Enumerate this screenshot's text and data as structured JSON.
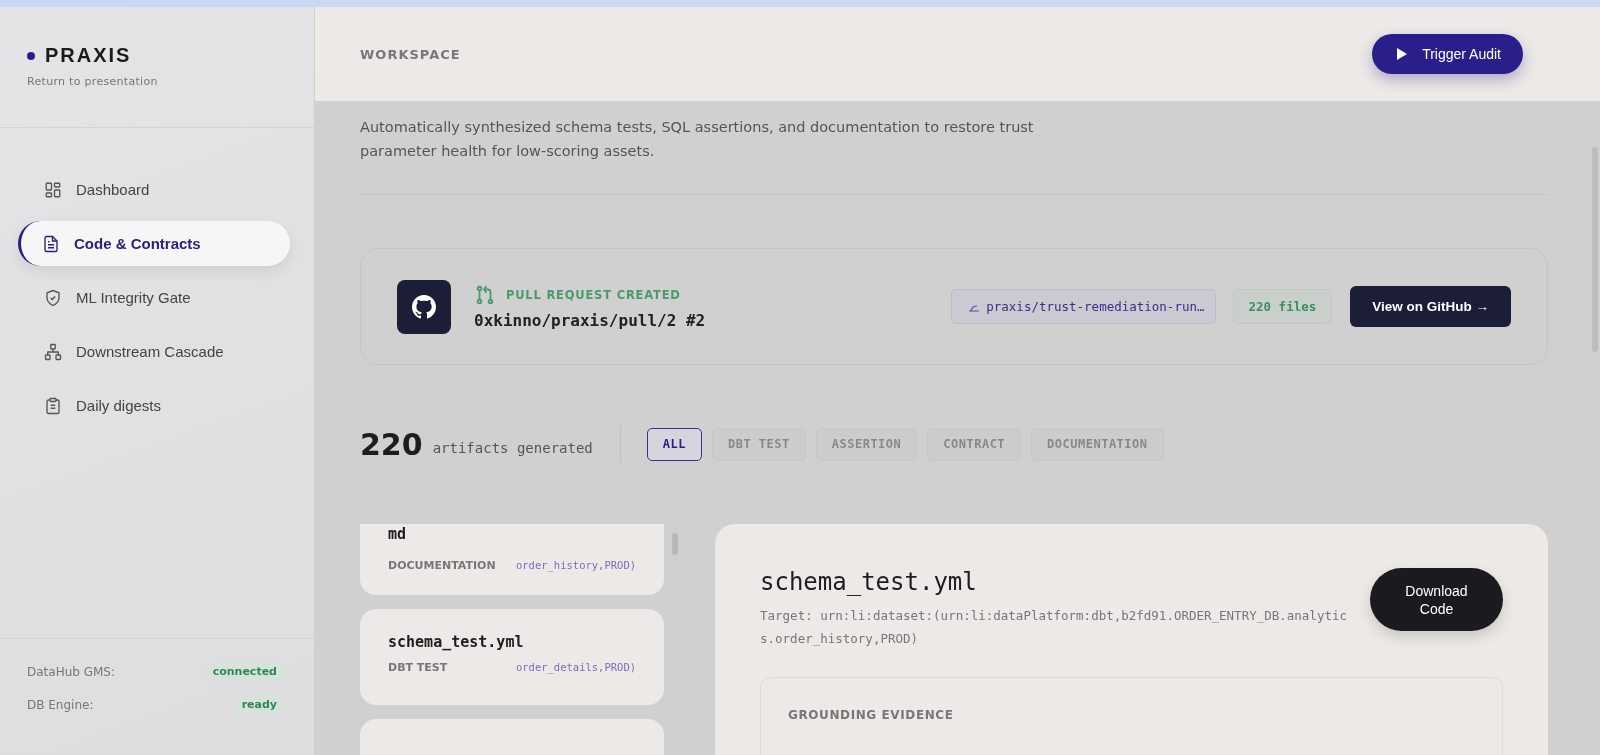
{
  "sidebar": {
    "brand": "PRAXIS",
    "back_link": "Return to presentation",
    "items": [
      {
        "label": "Dashboard",
        "selected": false
      },
      {
        "label": "Code & Contracts",
        "selected": true
      },
      {
        "label": "ML Integrity Gate",
        "selected": false
      },
      {
        "label": "Downstream Cascade",
        "selected": false
      },
      {
        "label": "Daily digests",
        "selected": false
      }
    ],
    "status": [
      {
        "label": "DataHub GMS:",
        "value": "connected"
      },
      {
        "label": "DB Engine:",
        "value": "ready"
      }
    ]
  },
  "header": {
    "title": "WORKSPACE",
    "action": "Trigger Audit"
  },
  "description": "Automatically synthesized schema tests, SQL assertions, and documentation to restore trust parameter health for low-scoring assets.",
  "pull_request": {
    "status": "PULL REQUEST CREATED",
    "path": "0xkinno/praxis/pull/2 #2",
    "branch": "praxis/trust-remediation-run…",
    "files": "220 files",
    "button": "View on GitHub →"
  },
  "artifacts": {
    "count": "220",
    "label": "artifacts generated",
    "filters": [
      {
        "label": "ALL",
        "selected": true
      },
      {
        "label": "DBT TEST",
        "selected": false
      },
      {
        "label": "ASSERTION",
        "selected": false
      },
      {
        "label": "CONTRACT",
        "selected": false
      },
      {
        "label": "DOCUMENTATION",
        "selected": false
      }
    ],
    "items": [
      {
        "name": "md",
        "type": "DOCUMENTATION",
        "target": "order_history,PROD)"
      },
      {
        "name": "schema_test.yml",
        "type": "DBT TEST",
        "target": "order_details,PROD)"
      }
    ]
  },
  "detail": {
    "name": "schema_test.yml",
    "target": "Target: urn:li:dataset:(urn:li:dataPlatform:dbt,b2fd91.ORDER_ENTRY_DB.analytics.order_history,PROD)",
    "button": "Download Code",
    "section": "GROUNDING EVIDENCE"
  }
}
